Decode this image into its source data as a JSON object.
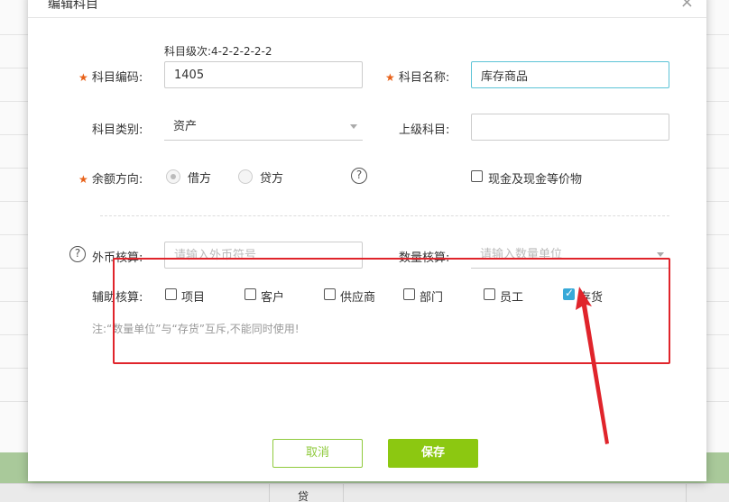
{
  "modal": {
    "title": "编辑科目",
    "close_glyph": "×"
  },
  "form": {
    "level_hint_label": "科目级次:",
    "level_hint_value": "4-2-2-2-2-2",
    "required_mark": "★",
    "code_label": "科目编码:",
    "code_value": "1405",
    "name_label": "科目名称:",
    "name_value": "库存商品",
    "category_label": "科目类别:",
    "category_value": "资产",
    "parent_label": "上级科目:",
    "parent_value": "",
    "balance_label": "余额方向:",
    "balance_options": [
      "借方",
      "贷方"
    ],
    "balance_selected": "借方",
    "cash_equiv_label": "现金及现金等价物",
    "help_glyph": "?",
    "fx_label": "外币核算:",
    "fx_placeholder": "请输入外币符号",
    "qty_label": "数量核算:",
    "qty_placeholder": "请输入数量单位",
    "aux_label": "辅助核算:",
    "aux_items": [
      {
        "label": "项目",
        "checked": false
      },
      {
        "label": "客户",
        "checked": false
      },
      {
        "label": "供应商",
        "checked": false
      },
      {
        "label": "部门",
        "checked": false
      },
      {
        "label": "员工",
        "checked": false
      },
      {
        "label": "存货",
        "checked": true
      }
    ],
    "note": "注:“数量单位”与“存货”互斥,不能同时使用!"
  },
  "buttons": {
    "cancel": "取消",
    "save": "保存"
  },
  "background": {
    "cell_text": "贷"
  },
  "colors": {
    "required": "#e8621a",
    "accent_green": "#8cc811",
    "checkbox_checked": "#38a9d8",
    "annotation_red": "#e0242b"
  }
}
